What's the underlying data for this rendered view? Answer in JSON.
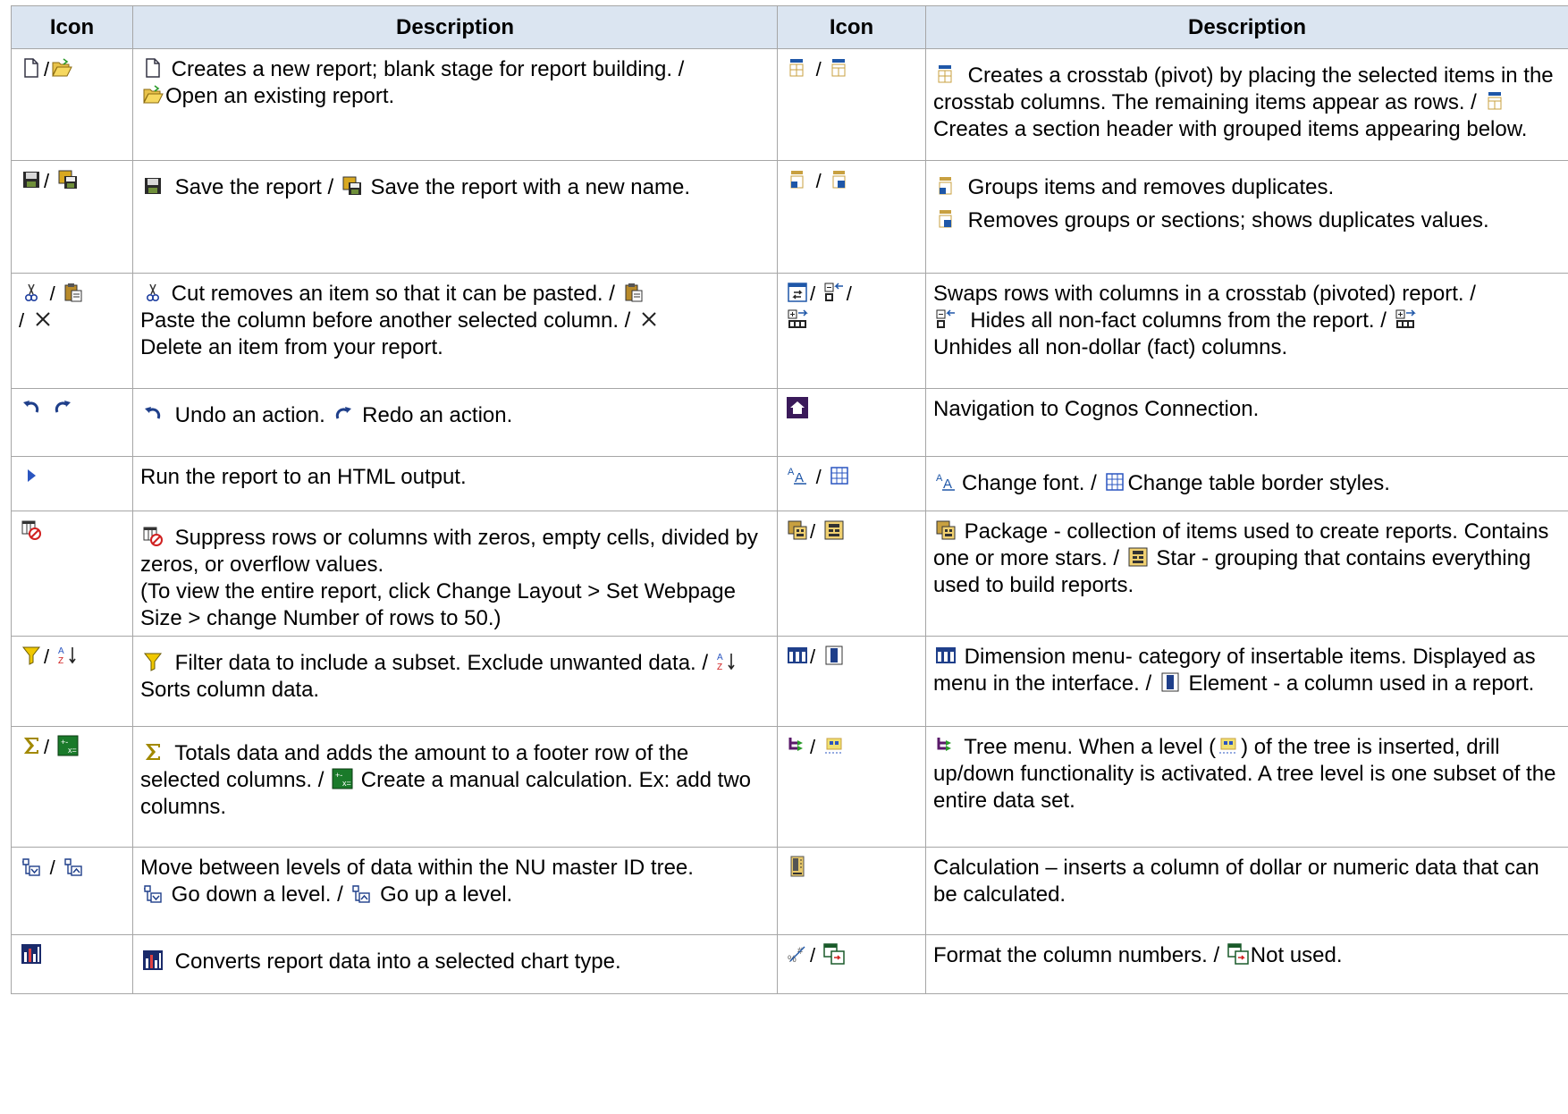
{
  "headers": {
    "icon": "Icon",
    "description": "Description"
  },
  "sep": "/",
  "rows": [
    {
      "left": {
        "icons": [
          "new-report-icon",
          "open-report-icon"
        ],
        "t1": "Creates a new report; blank stage for report building. /",
        "t2": "Open an existing report."
      },
      "right": {
        "icons": [
          "crosstab-icon",
          "section-header-icon"
        ],
        "t1": "Creates a crosstab (pivot) by placing the selected items in the crosstab columns. The remaining items appear as rows. /",
        "t2": "Creates a section header with grouped items appearing below."
      }
    },
    {
      "left": {
        "icons": [
          "save-icon",
          "save-as-icon"
        ],
        "t1": "Save the report /",
        "t2": "Save the report with a new name."
      },
      "right": {
        "icons": [
          "group-icon",
          "ungroup-icon"
        ],
        "t1": "Groups items and removes duplicates.",
        "t2": "Removes groups or sections; shows duplicates values."
      }
    },
    {
      "left": {
        "icons": [
          "cut-icon",
          "paste-icon",
          "delete-icon"
        ],
        "t1": "Cut removes an item so that it can be pasted. /",
        "t2": "Paste the column before another selected column. /",
        "t3": "Delete an item from your report."
      },
      "right": {
        "icons": [
          "swap-rows-columns-icon",
          "hide-columns-icon",
          "unhide-columns-icon"
        ],
        "t1": "Swaps rows with columns in a crosstab (pivoted) report. /",
        "t2": "Hides all non-fact columns from the report. /",
        "t3": "Unhides all non-dollar (fact) columns."
      }
    },
    {
      "left": {
        "icons": [
          "undo-icon",
          "redo-icon"
        ],
        "t1": "Undo an action.",
        "t2": "Redo an action."
      },
      "right": {
        "icons": [
          "home-icon"
        ],
        "t1": "Navigation to Cognos Connection."
      }
    },
    {
      "left": {
        "icons": [
          "run-icon"
        ],
        "t1": "Run the report to an HTML output."
      },
      "right": {
        "icons": [
          "font-icon",
          "border-icon"
        ],
        "t1": "Change font. /",
        "t2": "Change table border styles."
      }
    },
    {
      "left": {
        "icons": [
          "suppress-icon"
        ],
        "t1": "Suppress rows or columns with zeros, empty cells, divided by zeros, or overflow values.",
        "t2": "(To view the entire report, click Change Layout > Set Webpage Size > change Number of rows to 50.)"
      },
      "right": {
        "icons": [
          "package-icon",
          "star-icon"
        ],
        "t1": "Package - collection of items used to create reports. Contains one or more stars. /",
        "t2": "Star - grouping that contains everything used to build reports."
      }
    },
    {
      "left": {
        "icons": [
          "filter-icon",
          "sort-icon"
        ],
        "t1": "Filter data to include a subset. Exclude unwanted data. /",
        "t2": "Sorts column data."
      },
      "right": {
        "icons": [
          "dimension-icon",
          "element-icon"
        ],
        "t1": "Dimension menu- category of insertable items. Displayed as menu in the interface. /",
        "t2": "Element - a column used in a report."
      }
    },
    {
      "left": {
        "icons": [
          "sum-icon",
          "calculation-icon"
        ],
        "t1": "Totals data and adds the amount to a footer row of the selected columns. /",
        "t2": "Create a manual calculation. Ex: add two columns."
      },
      "right": {
        "icons": [
          "tree-icon",
          "level-icon"
        ],
        "t1": "Tree menu. When a level (",
        "t2": ") of the tree is inserted, drill up/down functionality is activated. A tree level is one subset of the entire data set."
      }
    },
    {
      "left": {
        "icons": [
          "down-level-icon",
          "up-level-icon"
        ],
        "t1": "Move between levels of data within the NU master ID tree.",
        "t2": "Go down a level. /",
        "t3": "Go up a level."
      },
      "right": {
        "icons": [
          "calc-column-icon"
        ],
        "t1": "Calculation – inserts a column of dollar or numeric data that can be calculated."
      }
    },
    {
      "left": {
        "icons": [
          "chart-icon"
        ],
        "t1": "Converts report data into a selected chart type."
      },
      "right": {
        "icons": [
          "format-numbers-icon",
          "not-used-icon"
        ],
        "t1": "Format the column numbers. /",
        "t2": "Not used."
      }
    }
  ]
}
